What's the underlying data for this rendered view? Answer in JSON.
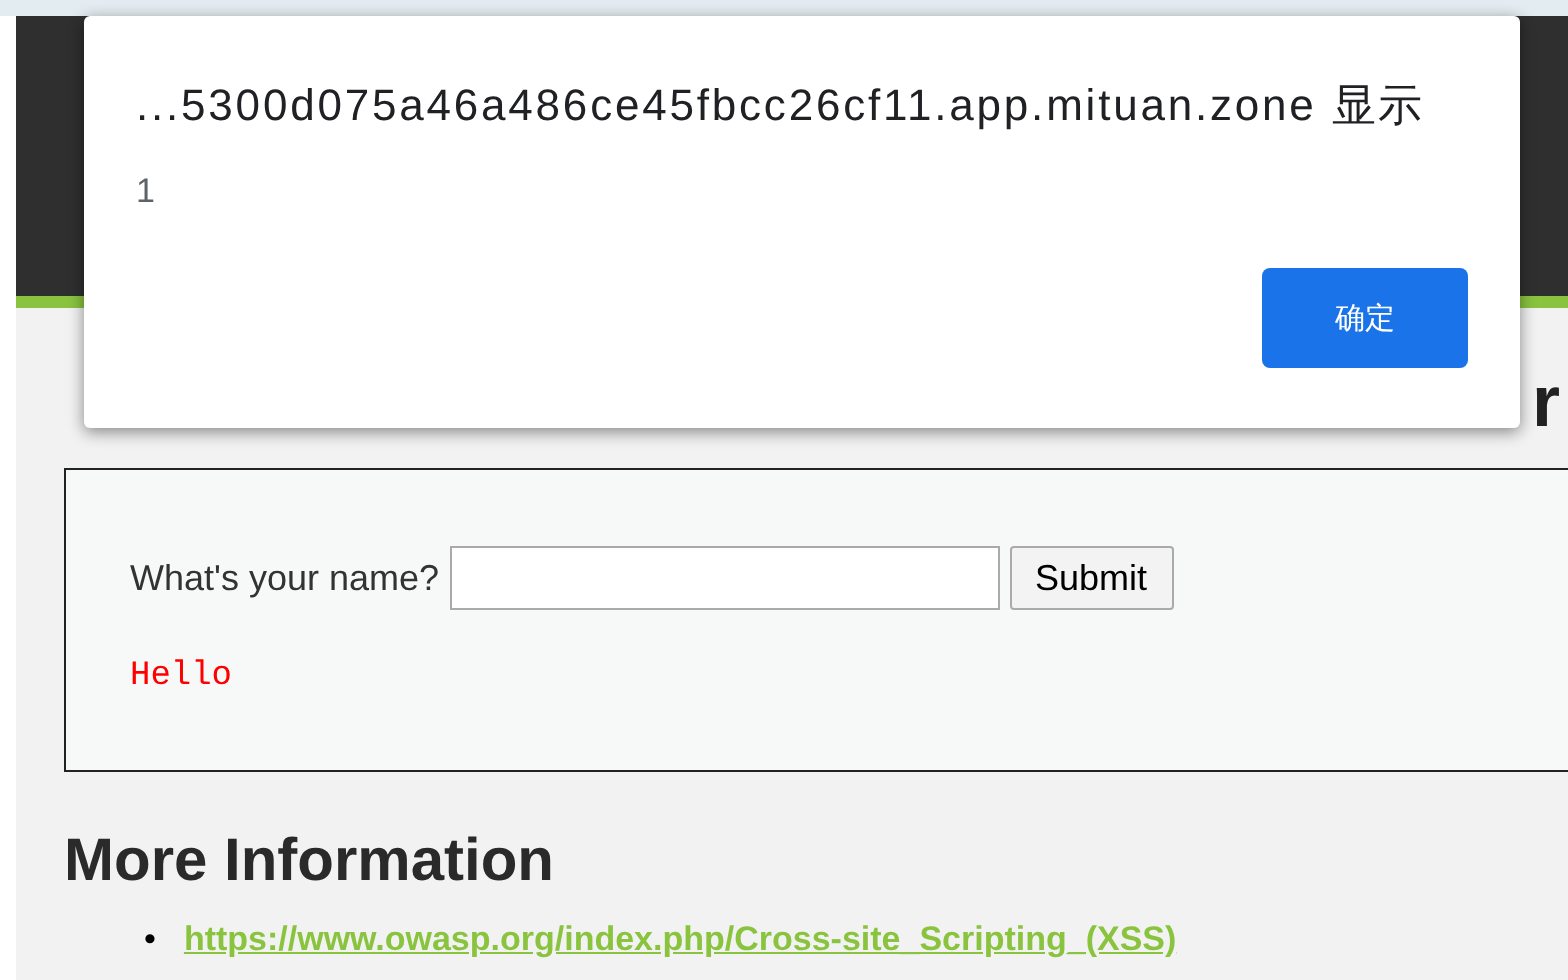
{
  "page": {
    "heading_visible_end": "r",
    "form": {
      "label": "What's your name?",
      "submit": "Submit",
      "output": "Hello"
    },
    "more_information": {
      "title": "More Information",
      "links": [
        {
          "bullet": "•",
          "text": "https://www.owasp.org/index.php/Cross-site_Scripting_(XSS)"
        }
      ]
    }
  },
  "dialog": {
    "title": "...5300d075a46a486ce45fbcc26cf11.app.mituan.zone 显示",
    "message": "1",
    "ok_button": "确定"
  }
}
